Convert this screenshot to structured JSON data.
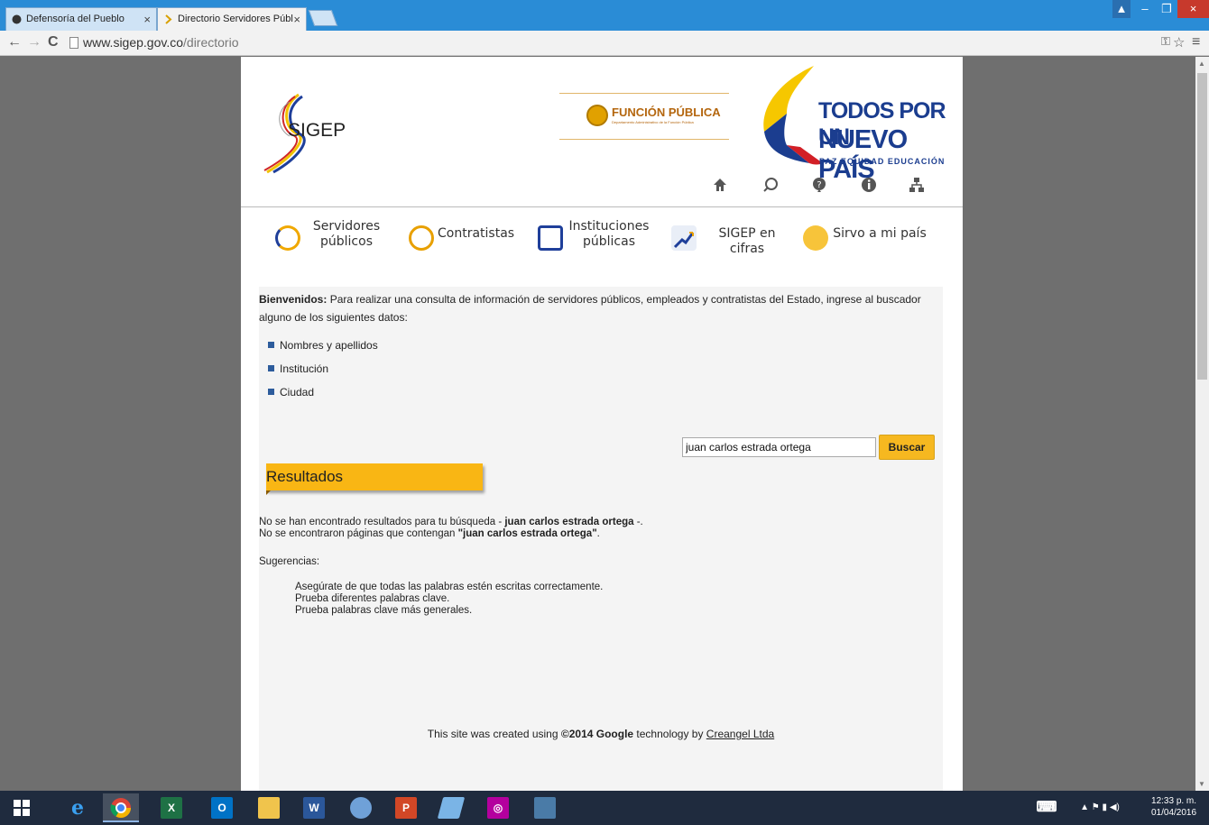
{
  "browser": {
    "tabs": [
      {
        "title": "Defensoría del Pueblo",
        "active": false
      },
      {
        "title": "Directorio Servidores Públ",
        "active": true
      }
    ],
    "url_host": "www.sigep.gov.co",
    "url_path": "/directorio"
  },
  "header": {
    "sigep_logo_text": "SIGEP",
    "funcion_publica_title": "FUNCIÓN PÚBLICA",
    "funcion_publica_subtitle": "Departamento Administrativo de la Función Pública",
    "tpun_line1": "TODOS POR UN",
    "tpun_line2": "NUEVO PAÍS",
    "tpun_line3": "PAZ  EQUIDAD  EDUCACIÓN",
    "icons": [
      "home-icon",
      "search-icon",
      "help-icon",
      "info-icon",
      "sitemap-icon"
    ]
  },
  "menu": {
    "items": [
      {
        "label_line1": "Servidores",
        "label_line2": "públicos",
        "icon": "servidores-icon"
      },
      {
        "label_line1": "Contratistas",
        "label_line2": "",
        "icon": "contratistas-icon"
      },
      {
        "label_line1": "Instituciones",
        "label_line2": "públicas",
        "icon": "instituciones-icon"
      },
      {
        "label_line1": "SIGEP en cifras",
        "label_line2": "",
        "icon": "cifras-icon"
      },
      {
        "label_line1": "Sirvo a mi país",
        "label_line2": "",
        "icon": "sirvo-icon"
      }
    ]
  },
  "intro": {
    "bold": "Bienvenidos:",
    "text": "Para realizar una consulta de información de servidores públicos, empleados y contratistas del Estado, ingrese al buscador alguno de los siguientes datos:",
    "bullets": [
      "Nombres y apellidos",
      "Institución",
      "Ciudad"
    ]
  },
  "search": {
    "value": "juan carlos estrada ortega",
    "button_label": "Buscar"
  },
  "results": {
    "title": "Resultados",
    "line1_prefix": "No se han encontrado resultados para tu búsqueda - ",
    "line1_query": "juan carlos estrada ortega",
    "line1_suffix": " -.",
    "line2_prefix": "No se encontraron páginas que contengan ",
    "line2_query": "\"juan carlos estrada ortega\"",
    "line2_suffix": ".",
    "suggestions_title": "Sugerencias:",
    "suggestions": [
      "Asegúrate de que todas las palabras estén escritas correctamente.",
      "Prueba diferentes palabras clave.",
      "Prueba palabras clave más generales."
    ]
  },
  "footer": {
    "prefix": "This site was created using ",
    "bold": "©2014 Google",
    "middle": " technology by ",
    "link": "Creangel Ltda"
  },
  "taskbar": {
    "time": "12:33 p. m.",
    "date": "01/04/2016"
  }
}
